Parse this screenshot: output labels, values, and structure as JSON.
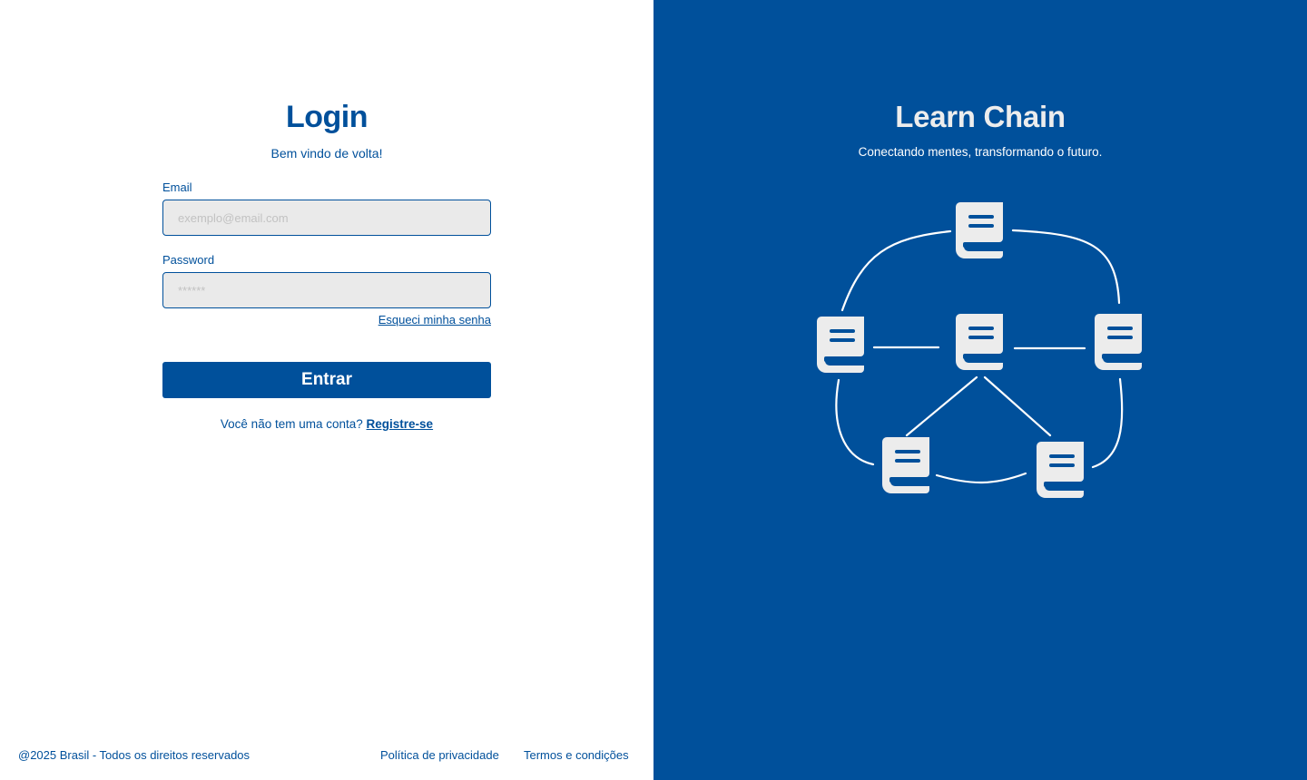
{
  "login": {
    "title": "Login",
    "subtitle": "Bem vindo de volta!",
    "email_label": "Email",
    "email_placeholder": "exemplo@email.com",
    "email_value": "",
    "password_label": "Password",
    "password_placeholder": "******",
    "password_value": "",
    "forgot_password": "Esqueci minha senha",
    "submit_label": "Entrar",
    "register_prompt": "Você não tem uma conta?",
    "register_link": "Registre-se"
  },
  "footer": {
    "copyright": "@2025 Brasil - Todos os direitos reservados",
    "privacy": "Política de privacidade",
    "terms": "Termos e condições"
  },
  "brand": {
    "title": "Learn Chain",
    "subtitle": "Conectando mentes, transformando o futuro.",
    "illustration_icons": [
      "book-icon",
      "book-icon",
      "book-icon",
      "book-icon",
      "book-icon",
      "book-icon"
    ]
  },
  "colors": {
    "primary": "#00509b",
    "input_background": "#eaeaea",
    "panel_text": "#ededed",
    "background": "#ffffff"
  }
}
